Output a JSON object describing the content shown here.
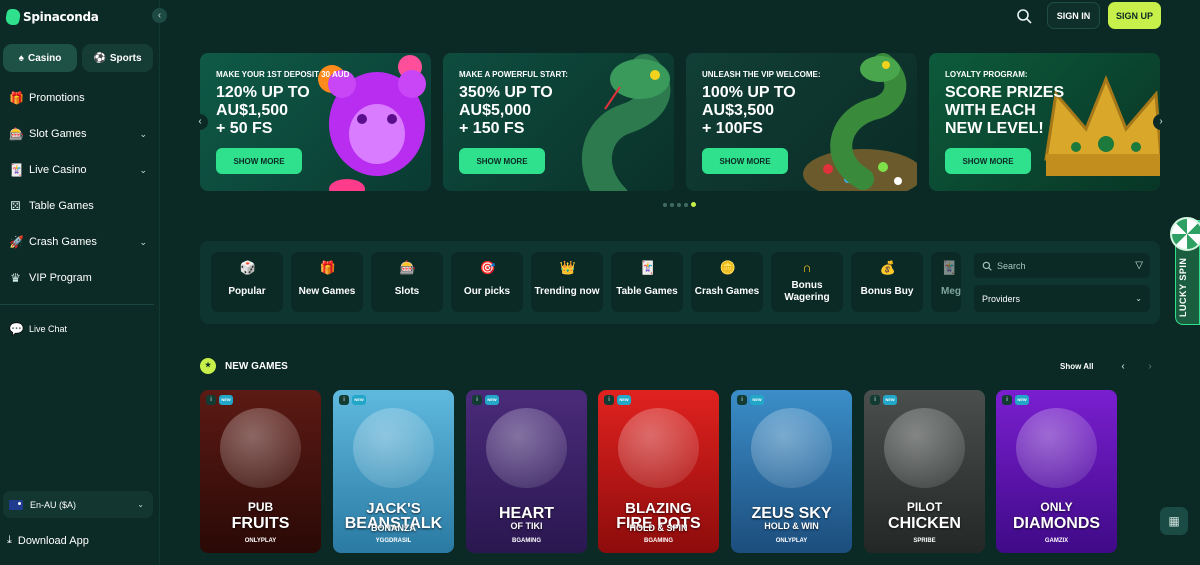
{
  "brand": {
    "name": "Spinaconda",
    "accent": "#2fe08d",
    "cta": "#c7f04a",
    "bg": "#0c2a25"
  },
  "sidebar": {
    "tabs": [
      {
        "label": "Casino",
        "icon": "spade-icon"
      },
      {
        "label": "Sports",
        "icon": "soccer-ball-icon"
      }
    ],
    "items": [
      {
        "label": "Promotions",
        "icon": "gift-icon",
        "expandable": false
      },
      {
        "label": "Slot Games",
        "icon": "slot-machine-icon",
        "expandable": true
      },
      {
        "label": "Live Casino",
        "icon": "cards-icon",
        "expandable": true
      },
      {
        "label": "Table Games",
        "icon": "dice-icon",
        "expandable": false
      },
      {
        "label": "Crash Games",
        "icon": "rocket-icon",
        "expandable": true
      },
      {
        "label": "VIP Program",
        "icon": "crown-icon",
        "expandable": false
      }
    ],
    "live_chat": "Live Chat",
    "language": "En-AU ($A)",
    "download": "Download App"
  },
  "header": {
    "signin": "SIGN IN",
    "signup": "SIGN UP"
  },
  "banners": [
    {
      "kicker": "MAKE YOUR 1ST DEPOSIT 30 AUD",
      "headline": "120% UP TO\nAU$1,500\n+ 50 FS",
      "button": "SHOW MORE"
    },
    {
      "kicker": "MAKE A POWERFUL START:",
      "headline": "350% UP TO\nAU$5,000\n+ 150 FS",
      "button": "SHOW MORE"
    },
    {
      "kicker": "UNLEASH THE VIP WELCOME:",
      "headline": "100% UP TO\nAU$3,500\n+ 100FS",
      "button": "SHOW MORE"
    },
    {
      "kicker": "LOYALTY PROGRAM:",
      "headline": "SCORE PRIZES\nWITH EACH\nNEW LEVEL!",
      "button": "SHOW MORE"
    }
  ],
  "carousel": {
    "dots": 5,
    "active_dot": 5
  },
  "categories": [
    {
      "label": "Popular",
      "icon": "dice-icon"
    },
    {
      "label": "New Games",
      "icon": "gift-icon"
    },
    {
      "label": "Slots",
      "icon": "slot-machine-icon"
    },
    {
      "label": "Our picks",
      "icon": "target-icon"
    },
    {
      "label": "Trending now",
      "icon": "crown-icon"
    },
    {
      "label": "Table Games",
      "icon": "cards-icon"
    },
    {
      "label": "Crash Games",
      "icon": "chip-icon"
    },
    {
      "label": "Bonus Wagering",
      "icon": "horseshoe-icon"
    },
    {
      "label": "Bonus Buy",
      "icon": "money-bag-icon"
    },
    {
      "label": "Meg",
      "icon": "cards-icon"
    }
  ],
  "filters": {
    "search_placeholder": "Search",
    "providers": "Providers"
  },
  "lucky_spin": "LUCKY SPIN",
  "new_games": {
    "title": "NEW GAMES",
    "show_all": "Show All",
    "games": [
      {
        "line1": "PUB",
        "line2": "FRUITS",
        "provider": "ONLYPLAY",
        "bg1": "#5c1a14",
        "bg2": "#2a0906"
      },
      {
        "line1": "JACK'S",
        "line2": "BEANSTALK",
        "sub": "BONANZA",
        "provider": "YGGDRASIL",
        "bg1": "#5fb9df",
        "bg2": "#2a7aa3"
      },
      {
        "line1": "HEART",
        "sub": "OF TIKI",
        "provider": "BGAMING",
        "bg1": "#4a2b7a",
        "bg2": "#2a1750"
      },
      {
        "line1": "BLAZING",
        "line2": "FIRE POTS",
        "sub": "HOLD & SPIN",
        "provider": "BGAMING",
        "bg1": "#e0221f",
        "bg2": "#8d0c0c"
      },
      {
        "line1": "ZEUS SKY",
        "sub": "HOLD & WIN",
        "provider": "ONLYPLAY",
        "bg1": "#3b8ec9",
        "bg2": "#1c4d7d"
      },
      {
        "line1": "PILOT",
        "line2": "CHICKEN",
        "provider": "SPRIBE",
        "bg1": "#4a4f4d",
        "bg2": "#232725"
      },
      {
        "line1": "ONLY",
        "line2": "DIAMONDS",
        "provider": "GAMZIX",
        "bg1": "#7a1fd0",
        "bg2": "#3f0a87"
      }
    ],
    "info_label": "i",
    "new_label": "NEW"
  }
}
